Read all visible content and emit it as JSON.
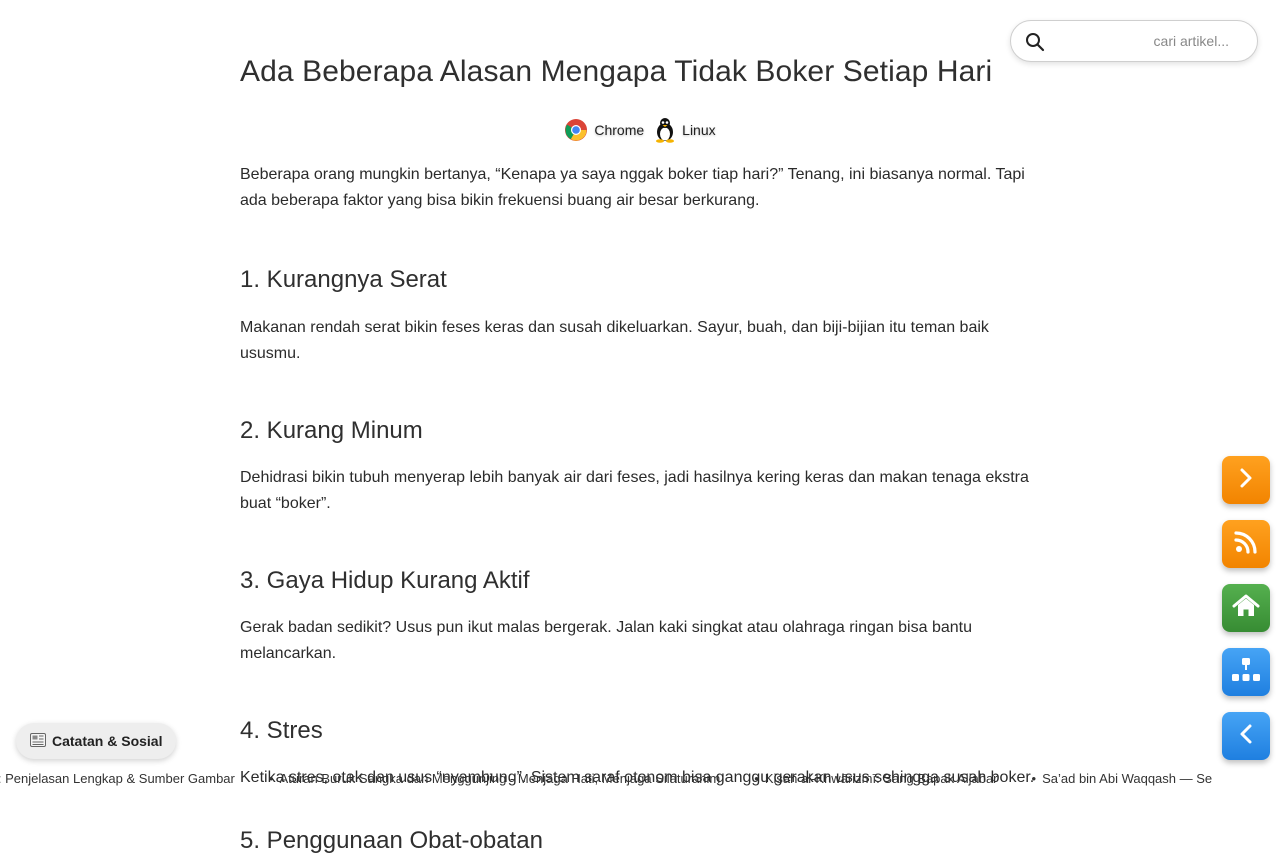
{
  "article": {
    "title": "Ada Beberapa Alasan Mengapa Tidak Boker Setiap Hari",
    "env": [
      {
        "label": "Chrome",
        "icon": "chrome-icon"
      },
      {
        "label": "Linux",
        "icon": "tux-icon"
      }
    ],
    "intro": "Beberapa orang mungkin bertanya, “Kenapa ya saya nggak boker tiap hari?” Tenang, ini biasanya normal. Tapi ada beberapa faktor yang bisa bikin frekuensi buang air besar berkurang.",
    "sections": [
      {
        "heading": "1. Kurangnya Serat",
        "text": "Makanan rendah serat bikin feses keras dan susah dikeluarkan. Sayur, buah, dan biji-bijian itu teman baik ususmu."
      },
      {
        "heading": "2. Kurang Minum",
        "text": "Dehidrasi bikin tubuh menyerap lebih banyak air dari feses, jadi hasilnya kering keras dan makan tenaga ekstra buat “boker”."
      },
      {
        "heading": "3. Gaya Hidup Kurang Aktif",
        "text": "Gerak badan sedikit? Usus pun ikut malas bergerak. Jalan kaki singkat atau olahraga ringan bisa bantu melancarkan."
      },
      {
        "heading": "4. Stres",
        "text": "Ketika stres, otak dan usus “nyambung”. Sistem saraf otonom bisa ganggu gerakan usus sehingga susah boker."
      },
      {
        "heading": "5. Penggunaan Obat-obatan",
        "text": ""
      }
    ]
  },
  "search": {
    "placeholder": "cari artikel...",
    "icon": "search-icon"
  },
  "fabs": [
    {
      "name": "next-button",
      "icon": "chevron-right-icon",
      "color": "#f58a07"
    },
    {
      "name": "rss-button",
      "icon": "rss-icon",
      "color": "#f58a07"
    },
    {
      "name": "home-button",
      "icon": "home-icon",
      "color": "#43a047"
    },
    {
      "name": "sitemap-button",
      "icon": "sitemap-icon",
      "color": "#2a8ce8"
    },
    {
      "name": "back-button",
      "icon": "chevron-left-icon",
      "color": "#2a8ce8"
    }
  ],
  "badge": {
    "icon": "newspaper-icon",
    "label": "Catatan & Sosial"
  },
  "ticker": {
    "items": [
      "acy : Penjelasan Lengkap & Sumber Gambar",
      "Aturan Buruk Sangka dan Menggunjing - Menjaga Hati, Menjaga Silaturahim",
      "Kisah al-Khwārizmī: Sang Bapak Aljabar",
      "Sa’ad bin Abi Waqqash — Se"
    ]
  }
}
